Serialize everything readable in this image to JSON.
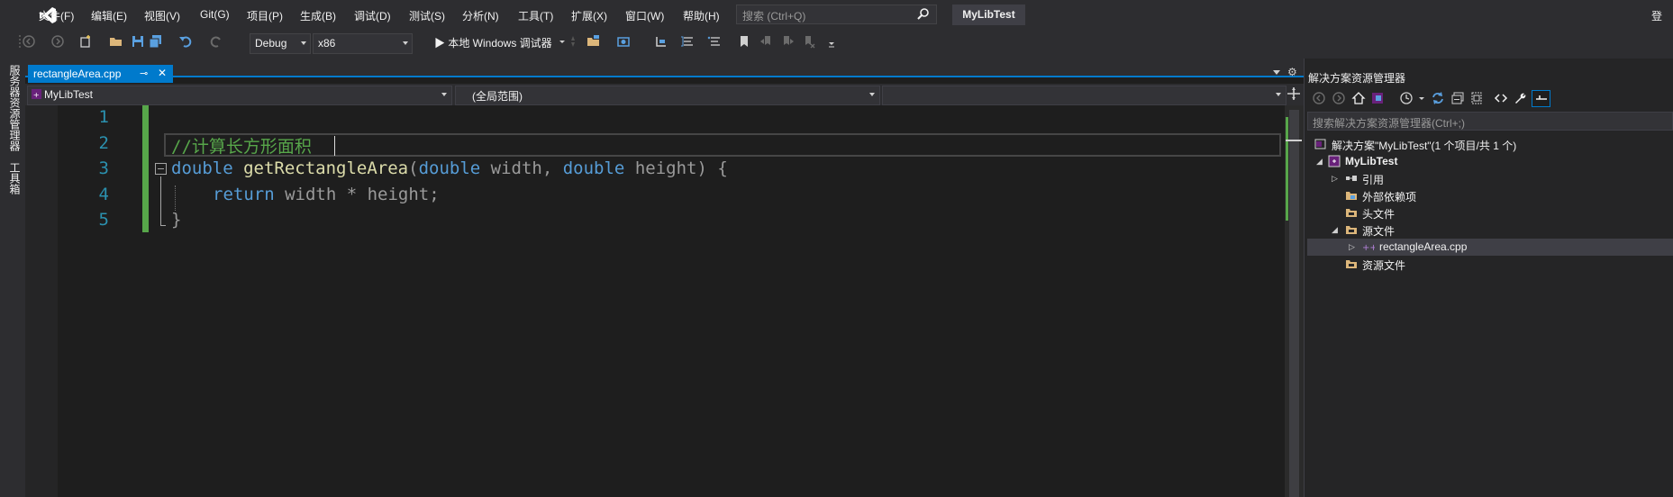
{
  "menubar": {
    "items": [
      "文件(F)",
      "编辑(E)",
      "视图(V)",
      "Git(G)",
      "项目(P)",
      "生成(B)",
      "调试(D)",
      "测试(S)",
      "分析(N)",
      "工具(T)",
      "扩展(X)",
      "窗口(W)",
      "帮助(H)"
    ],
    "search_placeholder": "搜索 (Ctrl+Q)",
    "project_title": "MyLibTest",
    "signin": "登"
  },
  "toolbar": {
    "config": "Debug",
    "platform": "x86",
    "run_label": "▶ 本地 Windows 调试器"
  },
  "left_strip": {
    "server_explorer": "服务器资源管理器",
    "toolbox": "工具箱"
  },
  "editor": {
    "tab_title": "rectangleArea.cpp",
    "tab_pin": "⊸",
    "tab_close": "✕",
    "nav_project": "MyLibTest",
    "nav_scope": "(全局范围)",
    "line_numbers": [
      "1",
      "2",
      "3",
      "4",
      "5"
    ],
    "code": {
      "line2_comment": "//计算长方形面积",
      "line3_kw1": "double",
      "line3_fn": "getRectangleArea",
      "line3_p1": "(",
      "line3_kw2": "double",
      "line3_id1": " width, ",
      "line3_kw3": "double",
      "line3_id2": " height) {",
      "line4_kw": "return",
      "line4_rest": " width * height;",
      "line5": "}"
    }
  },
  "solution_explorer": {
    "title": "解决方案资源管理器",
    "search_placeholder": "搜索解决方案资源管理器(Ctrl+;)",
    "tree": [
      {
        "label": "解决方案\"MyLibTest\"(1 个项目/共 1 个)",
        "icon": "solution-icon",
        "expander": ""
      },
      {
        "label": "MyLibTest",
        "icon": "cpp-project-icon",
        "expander": "◢"
      },
      {
        "label": "引用",
        "icon": "references-icon",
        "expander": "▷"
      },
      {
        "label": "外部依赖项",
        "icon": "external-deps-icon",
        "expander": ""
      },
      {
        "label": "头文件",
        "icon": "folder-filter-icon",
        "expander": ""
      },
      {
        "label": "源文件",
        "icon": "folder-filter-icon",
        "expander": "◢"
      },
      {
        "label": "rectangleArea.cpp",
        "icon": "cpp-file-icon",
        "expander": "▷"
      },
      {
        "label": "资源文件",
        "icon": "folder-filter-icon",
        "expander": ""
      }
    ]
  },
  "colors": {
    "accent": "#007acc",
    "keyword": "#569cd6",
    "function": "#dcdcaa",
    "comment": "#57a64a",
    "line_number": "#2b91af"
  }
}
